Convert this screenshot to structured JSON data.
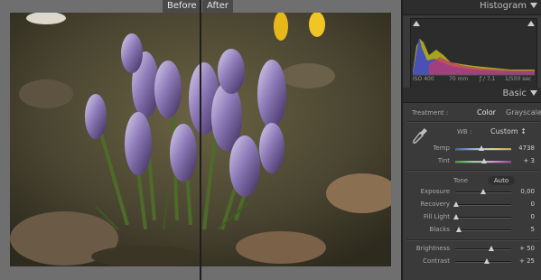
{
  "view": {
    "before_label": "Before",
    "after_label": "After"
  },
  "histogram": {
    "title": "Histogram",
    "iso": "ISO 400",
    "focal": "70 mm",
    "aperture": "ƒ / 7,1",
    "shutter": "1/500 sec"
  },
  "basic": {
    "title": "Basic",
    "treatment_label": "Treatment :",
    "treatment_color": "Color",
    "treatment_gray": "Grayscale",
    "wb_label": "WB :",
    "wb_value": "Custom ↕",
    "tone_label": "Tone",
    "auto_label": "Auto",
    "sliders": [
      {
        "label": "Temp",
        "value": "4738",
        "pos": 0.47,
        "kind": "temp"
      },
      {
        "label": "Tint",
        "value": "+ 3",
        "pos": 0.52,
        "kind": "tint"
      },
      {
        "label": "Exposure",
        "value": "0,00",
        "pos": 0.5,
        "kind": "gray"
      },
      {
        "label": "Recovery",
        "value": "0",
        "pos": 0.02,
        "kind": "gray"
      },
      {
        "label": "Fill Light",
        "value": "0",
        "pos": 0.02,
        "kind": "gray"
      },
      {
        "label": "Blacks",
        "value": "5",
        "pos": 0.06,
        "kind": "gray"
      },
      {
        "label": "Brightness",
        "value": "+ 50",
        "pos": 0.65,
        "kind": "gray"
      },
      {
        "label": "Contrast",
        "value": "+ 25",
        "pos": 0.57,
        "kind": "gray"
      }
    ]
  }
}
